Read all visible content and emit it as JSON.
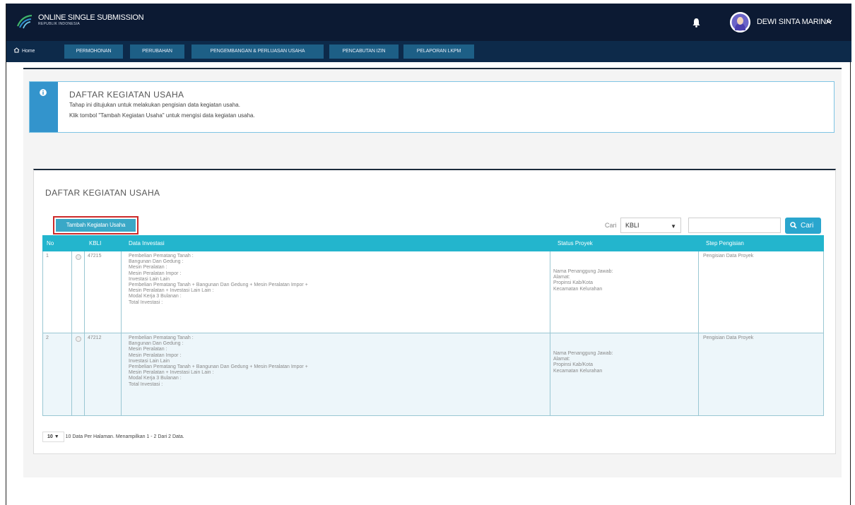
{
  "header": {
    "brand_title": "ONLINE SINGLE SUBMISSION",
    "brand_subtitle": "REPUBLIK INDONESIA",
    "user_name": "DEWI SINTA MARINA",
    "bg_color": "#0c1a33"
  },
  "nav": {
    "home": "Home",
    "items": [
      "PERMOHONAN",
      "PERUBAHAN",
      "PENGEMBANGAN & PERLUASAN USAHA",
      "PENCABUTAN IZIN",
      "PELAPORAN LKPM"
    ],
    "tab_color": "#1d5f86"
  },
  "info": {
    "title": "DAFTAR KEGIATAN USAHA",
    "line1": "Tahap ini ditujukan untuk melakukan pengisian data kegiatan usaha.",
    "line2": "Klik tombol \"Tambah Kegiatan Usaha\" untuk mengisi data kegiatan usaha."
  },
  "card": {
    "title": "DAFTAR KEGIATAN USAHA",
    "add_button": "Tambah Kegiatan Usaha",
    "cari_label": "Cari",
    "select_value": "KBLI",
    "search_button": "Cari"
  },
  "table": {
    "headers": [
      "No",
      "KBLI",
      "Data Investasi",
      "Status Proyek",
      "Step Pengisian"
    ],
    "header_color": "#23b5cd",
    "rows": [
      {
        "no": "1",
        "kbli": "47215",
        "investasi": [
          "Pembelian Pematang Tanah :",
          "Bangunan Dan Gedung :",
          "Mesin Peralatan :",
          "Mesin Peralatan Impor :",
          "Investasi Lain Lain",
          "Pembelian Pematang Tanah + Bangunan Dan Gedung + Mesin Peralatan Impor +",
          "Mesin Peralatan + Investasi Lain Lain :",
          "Modal Kerja 3 Bulanan :",
          "Total Investasi :"
        ],
        "status": [
          "Nama Penanggung Jawab:",
          "Alamat:",
          "Propinsi Kab/Kota",
          "Kecamatan Kelurahan"
        ],
        "step": "Pengisian Data Proyek"
      },
      {
        "no": "2",
        "kbli": "47212",
        "investasi": [
          "Pembelian Pematang Tanah :",
          "Bangunan Dan Gedung :",
          "Mesin Peralatan :",
          "Mesin Peralatan Impor :",
          "Investasi Lain Lain",
          "Pembelian Pematang Tanah + Bangunan Dan Gedung + Mesin Peralatan Impor +",
          "Mesin Peralatan + Investasi Lain Lain :",
          "Modal Kerja 3 Bulanan :",
          "Total Investasi :"
        ],
        "status": [
          "Nama Penanggung Jawab:",
          "Alamat:",
          "Propinsi Kab/Kota",
          "Kecamatan Kelurahan"
        ],
        "step": "Pengisian Data Proyek"
      }
    ]
  },
  "pager": {
    "page_size": "10",
    "summary": "10 Data Per Halaman. Menampilkan 1 - 2 Dari 2 Data."
  }
}
